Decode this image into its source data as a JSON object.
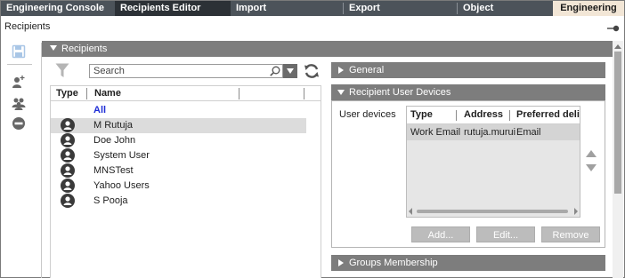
{
  "tabs": [
    {
      "label": "Engineering Console",
      "active": false
    },
    {
      "label": "Recipients Editor",
      "active": true
    },
    {
      "label": "Import",
      "active": false
    },
    {
      "label": "Export",
      "active": false
    },
    {
      "label": "Object Configurator",
      "active": false
    },
    {
      "label": "Engineering",
      "active": false
    }
  ],
  "page": {
    "title": "Recipients"
  },
  "toolbar": {
    "icons": [
      "save-icon",
      "add-user-icon",
      "add-group-icon",
      "remove-icon"
    ]
  },
  "recipients_panel": {
    "title": "Recipients"
  },
  "search": {
    "placeholder": "Search",
    "value": ""
  },
  "recipients_table": {
    "columns": [
      "Type",
      "Name"
    ],
    "rows": [
      {
        "name": "All",
        "selected": false,
        "icon": ""
      },
      {
        "name": "M Rutuja",
        "selected": true,
        "icon": "user-icon"
      },
      {
        "name": "Doe John",
        "selected": false,
        "icon": "user-icon"
      },
      {
        "name": "System User",
        "selected": false,
        "icon": "user-icon"
      },
      {
        "name": "MNSTest",
        "selected": false,
        "icon": "user-icon"
      },
      {
        "name": "Yahoo Users",
        "selected": false,
        "icon": "user-icon"
      },
      {
        "name": "S Pooja",
        "selected": false,
        "icon": "user-icon"
      }
    ]
  },
  "sections": {
    "general": "General",
    "devices": "Recipient User Devices",
    "groups": "Groups Membership"
  },
  "devices": {
    "label": "User devices",
    "columns": [
      "Type",
      "Address",
      "Preferred delive"
    ],
    "rows": [
      {
        "type": "Work Email",
        "address": "rutuja.murui",
        "preferred": "Email"
      }
    ],
    "buttons": {
      "add": "Add...",
      "edit": "Edit...",
      "remove": "Remove"
    }
  },
  "colors": {
    "tab_bar": "#4c535a",
    "tab_active": "#2c3136",
    "tab_engineering": "#f2e6d6",
    "section_header": "#7d7d7d",
    "selected_row": "#dcdcdc",
    "all_link": "#1f2fd6",
    "disabled_button": "#bcbcbc"
  }
}
